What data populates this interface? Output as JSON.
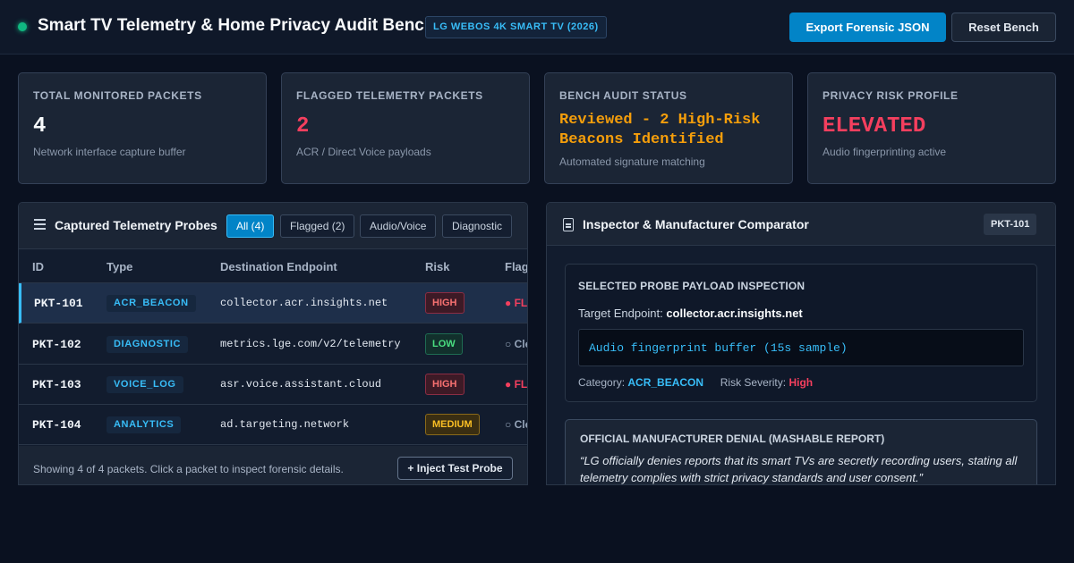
{
  "header": {
    "title": "Smart TV Telemetry & Home Privacy Audit Bench",
    "device_badge": "LG WEBOS 4K SMART TV (2026)",
    "export_label": "Export Forensic JSON",
    "reset_label": "Reset Bench",
    "status_color": "#10b981"
  },
  "stats": [
    {
      "label": "TOTAL MONITORED PACKETS",
      "value": "4",
      "sub": "Network interface capture buffer"
    },
    {
      "label": "FLAGGED TELEMETRY PACKETS",
      "value": "2",
      "sub": "ACR / Direct Voice payloads"
    },
    {
      "label": "BENCH AUDIT STATUS",
      "value": "Reviewed - 2 High-Risk Beacons Identified",
      "sub": "Automated signature matching"
    },
    {
      "label": "PRIVACY RISK PROFILE",
      "value": "ELEVATED",
      "sub": "Audio fingerprinting active"
    }
  ],
  "probes": {
    "title": "Captured Telemetry Probes",
    "filters": [
      "All (4)",
      "Flagged (2)",
      "Audio/Voice",
      "Diagnostic"
    ],
    "active_filter": "All (4)",
    "columns": [
      "ID",
      "Type",
      "Destination Endpoint",
      "Risk",
      "Flag"
    ],
    "rows": [
      {
        "id": "PKT-101",
        "type": "ACR_BEACON",
        "endpoint": "collector.acr.insights.net",
        "risk": "HIGH",
        "flag": "● FL",
        "flagged": true,
        "selected": true
      },
      {
        "id": "PKT-102",
        "type": "DIAGNOSTIC",
        "endpoint": "metrics.lge.com/v2/telemetry",
        "risk": "LOW",
        "flag": "○ Cle",
        "flagged": false,
        "selected": false
      },
      {
        "id": "PKT-103",
        "type": "VOICE_LOG",
        "endpoint": "asr.voice.assistant.cloud",
        "risk": "HIGH",
        "flag": "● FL",
        "flagged": true,
        "selected": false
      },
      {
        "id": "PKT-104",
        "type": "ANALYTICS",
        "endpoint": "ad.targeting.network",
        "risk": "MEDIUM",
        "flag": "○ Cle",
        "flagged": false,
        "selected": false
      }
    ],
    "footer_text": "Showing 4 of 4 packets. Click a packet to inspect forensic details.",
    "inject_label": "+ Inject Test Probe"
  },
  "inspector": {
    "title": "Inspector & Manufacturer Comparator",
    "selected_badge": "PKT-101",
    "inspection_title": "SELECTED PROBE PAYLOAD INSPECTION",
    "target_label": "Target Endpoint:",
    "target_value": "collector.acr.insights.net",
    "payload": "Audio fingerprint buffer (15s sample)",
    "category_label": "Category:",
    "category_value": "ACR_BEACON",
    "severity_label": "Risk Severity:",
    "severity_value": "High",
    "denial_title": "OFFICIAL MANUFACTURER DENIAL (MASHABLE REPORT)",
    "denial_quote": "“LG officially denies reports that its smart TVs are secretly recording users, stating all telemetry complies with strict privacy standards and user consent.”"
  }
}
